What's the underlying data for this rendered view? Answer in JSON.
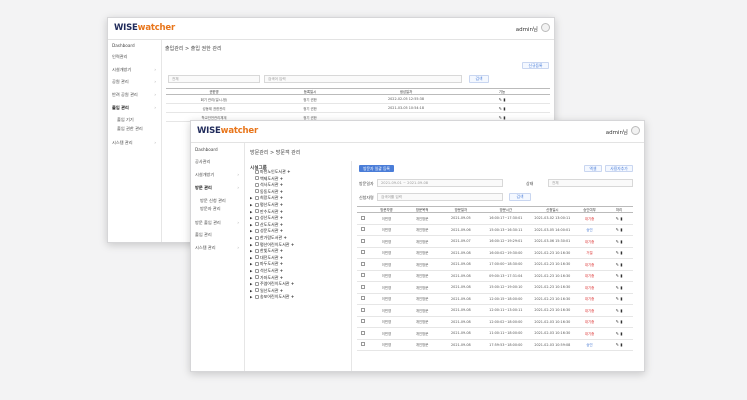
{
  "back": {
    "logo_a": "WISE",
    "logo_b": "watcher",
    "user": "admin님",
    "sidebar": [
      "Dashboard",
      "인력관리",
      "시설개방기",
      "공원 관리",
      "반려 공원 관리",
      "출입 관리",
      "출입 기기",
      "출입 권한 관리",
      "시스템 관리"
    ],
    "breadcrumb": "출입관리 > 출입 권한 관리",
    "top_button": "신규등록",
    "search_select": "전체",
    "search_placeholder": "검색어 입력",
    "search_button": "검색",
    "columns": [
      "권한명",
      "등록일시",
      "생성일자",
      "기능"
    ],
    "rows": [
      [
        "회기 관리(일시-정)",
        "정기 권한",
        "2022-02-05 12:55:38"
      ],
      [
        "성동제 권한관리",
        "정기 권한",
        "2021-03-05 10:54:18"
      ],
      [
        "학교안전관리체계",
        "정기 권한",
        ""
      ]
    ],
    "side_left": [
      "체육공원관리",
      "체육공원관리",
      "체육공원관리",
      "체육공원관리",
      "체육공원관리",
      "체육공원관리",
      "체육공원관리",
      "체육공원관리",
      "체육공원관리"
    ]
  },
  "front": {
    "logo_a": "WISE",
    "logo_b": "watcher",
    "user": "admin님",
    "sidebar": [
      "Dashboard",
      "공사관리",
      "시설개방기",
      "방문 관리",
      "방문 신청 관리",
      "방문자 관리",
      "방문 출입 관리",
      "출입 관리",
      "시스템 관리"
    ],
    "breadcrumb": "방문관리 > 방문객 관리",
    "tree_title": "시설그룹",
    "tree": [
      "마천노인도서관",
      "백제도서관",
      "석사도서관",
      "동동도서관",
      "희망도서관",
      "평산도서관",
      "만수도서관",
      "성산도서관",
      "산도도서관",
      "성문도서관",
      "한가람도서관",
      "평산어린이도서관",
      "한빛도서관",
      "대전도서관",
      "마두도서관",
      "석산도서관",
      "가좌도서관",
      "주엽어린이도서관",
      "일산도서관",
      "송포어린이도서관"
    ],
    "register_button": "방문자 일괄 등록",
    "export_button": "엑셀",
    "add_button": "사용자추가",
    "period_label": "방문일자",
    "period_value": "2021-09-01 ~ 2021-09-08",
    "status_label": "상태",
    "status_value": "전체",
    "name_label": "신청자명",
    "name_placeholder": "검색어를 입력",
    "search_button": "검색",
    "columns": [
      "",
      "방문자명",
      "방문목적",
      "방문일자",
      "방문시간",
      "신청일시",
      "승인여부",
      "처리"
    ],
    "rows": [
      [
        "",
        "이민영",
        "개인방문",
        "2021-09-05",
        "16:00:17~17:30:01",
        "2021-03-02 13:00:11",
        "대기중",
        "r"
      ],
      [
        "",
        "이민영",
        "개인방문",
        "2021-09-06",
        "15:00:13~16:30:11",
        "2021-03-05 14:00:01",
        "승인",
        "b"
      ],
      [
        "",
        "이민영",
        "개인방문",
        "2021-09-07",
        "16:00:12~19:29:01",
        "2021-03-06 15:30:01",
        "대기중",
        "r"
      ],
      [
        "",
        "이민영",
        "개인방문",
        "2021-09-08",
        "16:00:02~19:30:00",
        "2021-02-23 10:16:30",
        "거절",
        "r"
      ],
      [
        "",
        "이민영",
        "개인방문",
        "2021-09-08",
        "17:00:00~18:30:00",
        "2021-02-23 10:16:30",
        "대기중",
        "r"
      ],
      [
        "",
        "이민영",
        "개인방문",
        "2021-09-08",
        "09:00:13~17:31:04",
        "2021-02-23 10:16:30",
        "대기중",
        "r"
      ],
      [
        "",
        "이민영",
        "개인방문",
        "2021-09-08",
        "15:00:12~19:00:10",
        "2021-02-23 10:16:30",
        "대기중",
        "r"
      ],
      [
        "",
        "이민영",
        "개인방문",
        "2021-09-08",
        "12:00:15~18:00:00",
        "2021-02-23 10:16:30",
        "대기중",
        "r"
      ],
      [
        "",
        "이민영",
        "개인방문",
        "2021-09-08",
        "12:00:11~13:00:11",
        "2021-02-23 10:16:30",
        "대기중",
        "r"
      ],
      [
        "",
        "이민영",
        "개인방문",
        "2021-09-08",
        "12:00:02~18:00:00",
        "2021-02-03 10:16:30",
        "대기중",
        "r"
      ],
      [
        "",
        "이민영",
        "개인방문",
        "2021-09-08",
        "11:00:11~18:00:00",
        "2021-02-03 10:16:30",
        "대기중",
        "r"
      ],
      [
        "",
        "이민영",
        "개인방문",
        "2021-09-08",
        "17:59:53~18:00:00",
        "2021-02-03 10:59:08",
        "승인",
        "b"
      ]
    ]
  }
}
